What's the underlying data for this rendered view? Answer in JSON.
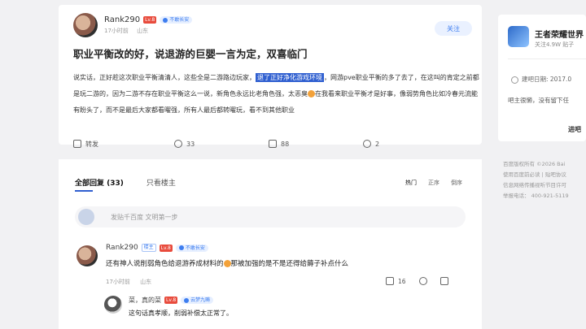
{
  "post": {
    "author": "Rank290",
    "level": "Lv.8",
    "tag": "不敢长安",
    "time": "17小时前",
    "location": "山东",
    "follow_label": "关注",
    "title": "职业平衡改的好，说退游的巨婴一言为定，双喜临门",
    "body_part1": "说实话，正好趁这次职业平衡清清人，这些全是二游路边玩家，",
    "body_highlight": "退了正好净化游戏环境",
    "body_part2": "，网游pve职业平衡的多了去了，在这叫的肯定之前都是玩二游的，因为二游不存在职业平衡这么一说，新角色永远比老角色强，太恶臭",
    "body_part3": "在我看来职业平衡才是好事，像弱势角色比如冷春元流能有盼头了，而不是最后大家都看曜强，所有人最后都转曜玩，看不到其他职业",
    "share_label": "转发",
    "comments_count": "33",
    "likes_count": "88",
    "favorites_count": "2"
  },
  "sidebar": {
    "forum_name": "王者荣耀世界",
    "forum_stats": "关注4.9W  贴子",
    "created": "建吧日期: 2017.0",
    "desc": "吧主很懒，没有留下任",
    "enter_label": "进吧"
  },
  "footer": {
    "line1": "百度版权所有  ©2026 Bai",
    "line2": "使用百度前必读  |  贴吧协议",
    "line3": "信息网络传播视听节目许可",
    "line4": "举报电话：  400-921-5119"
  },
  "replies": {
    "tab_all": "全部回复 (33)",
    "tab_owner": "只看楼主",
    "sort_hot": "热门",
    "sort_asc": "正序",
    "sort_desc": "倒序",
    "comment_placeholder": "发贴千百度 文明第一步",
    "items": [
      {
        "author": "Rank290",
        "owner_label": "楼主",
        "level": "Lv.8",
        "tag": "不敢长安",
        "text": "还有神人说削弱角色给退游养成材料的",
        "text2": "那被加强的是不是还得给薅子补点什么",
        "time": "17小时前",
        "location": "山东",
        "likes": "16"
      }
    ],
    "sub": {
      "author": "菜，真的菜",
      "level": "Lv.8",
      "tag": "云梦九畴",
      "text": "这句话真孝顺，削弱补偿太正常了。"
    }
  },
  "colors": {
    "accent": "#2f5fd0",
    "level_red": "#e84b3c",
    "follow_blue": "#3d7df0"
  }
}
